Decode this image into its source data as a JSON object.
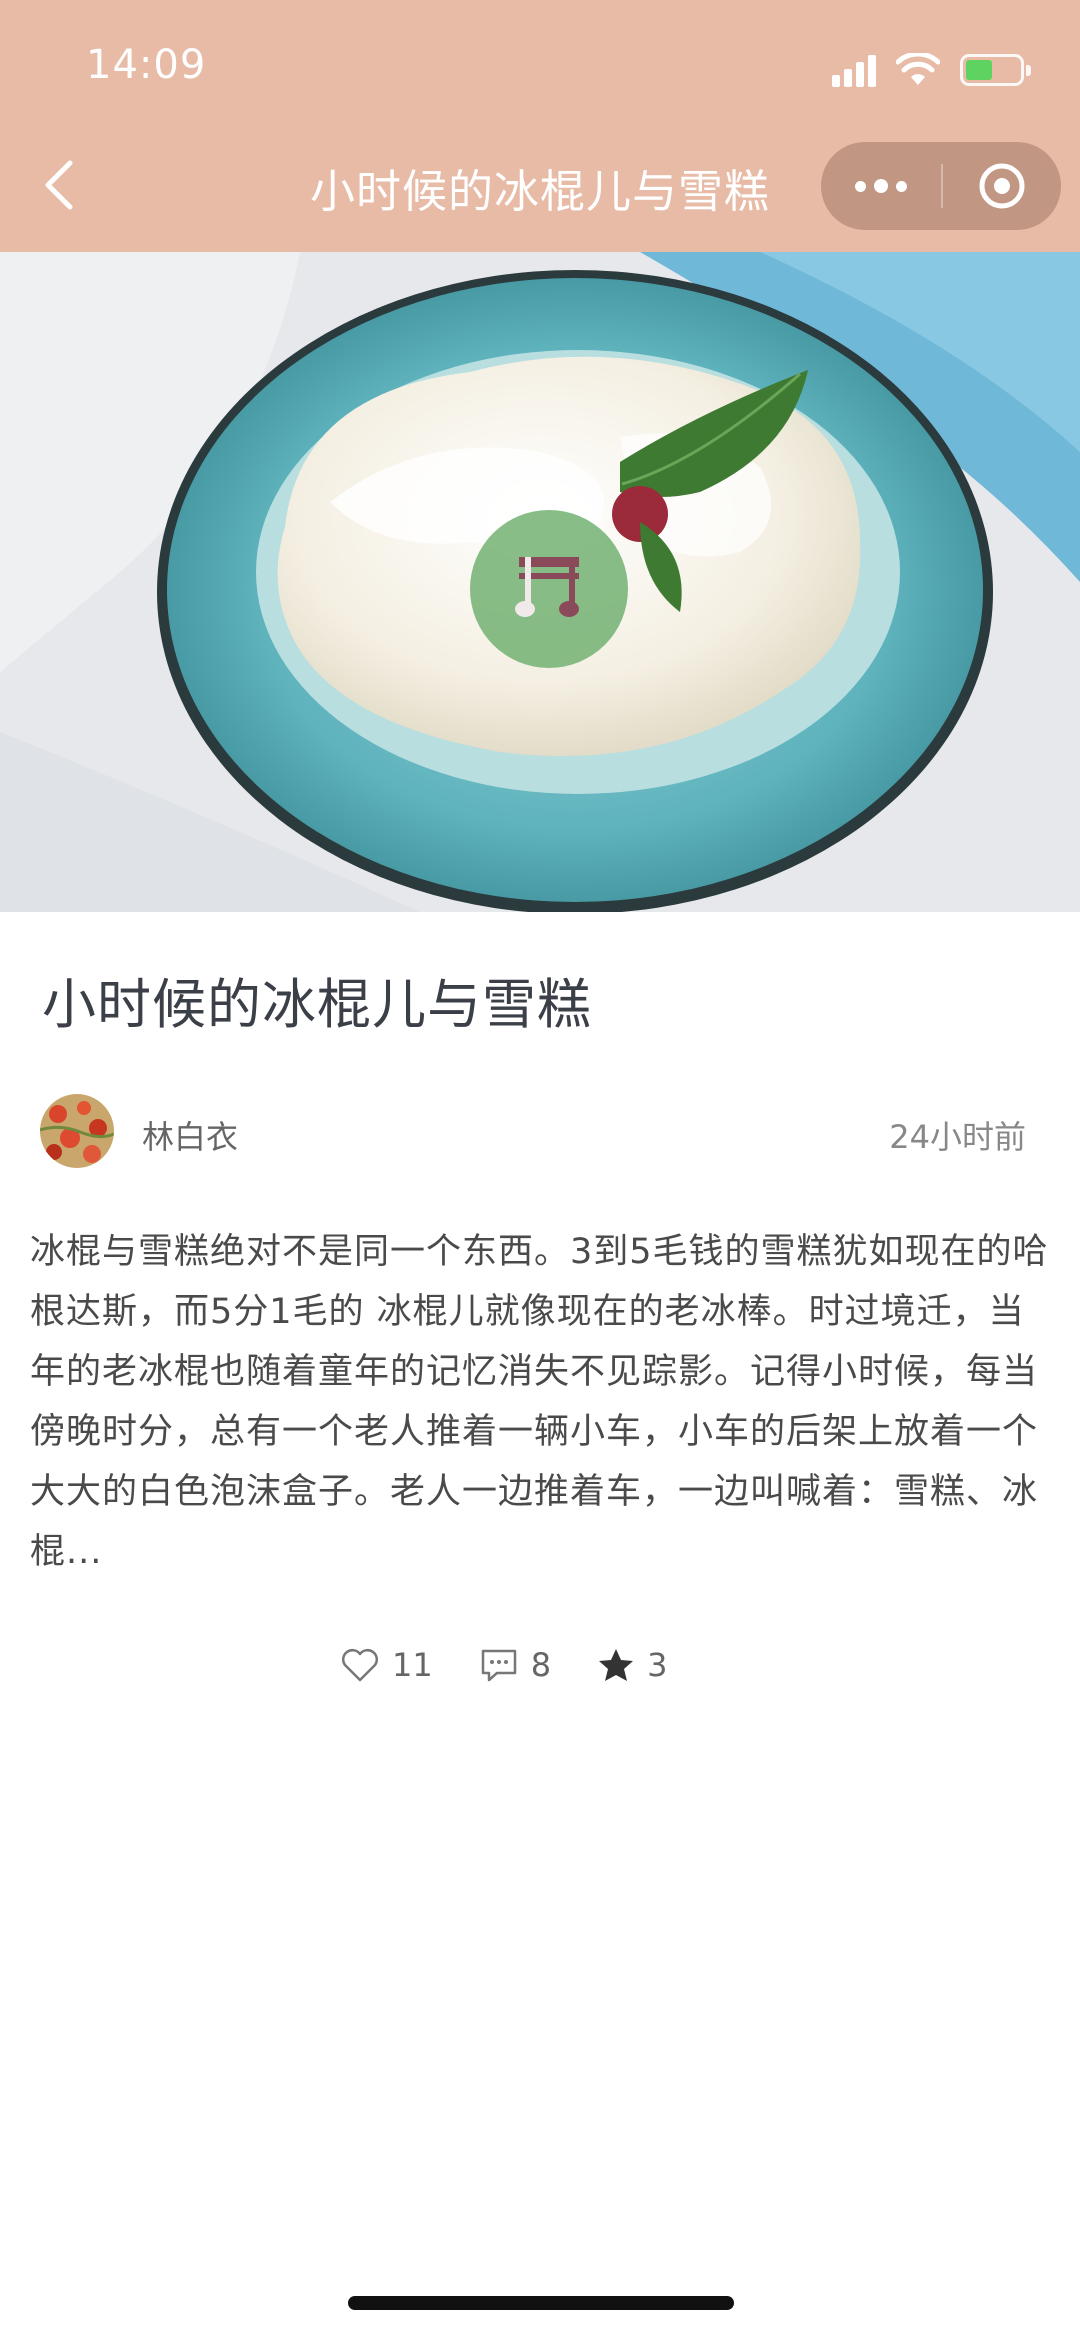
{
  "status_bar": {
    "time": "14:09",
    "icons": [
      "signal-icon",
      "wifi-icon",
      "battery-charging-icon"
    ]
  },
  "nav": {
    "title": "小时候的冰棍儿与雪糕",
    "back_icon": "chevron-left-icon",
    "more_icon": "more-dots-icon",
    "close_icon": "target-close-icon"
  },
  "hero": {
    "music_icon": "music-note-icon"
  },
  "article": {
    "title": "小时候的冰棍儿与雪糕",
    "author": "林白衣",
    "time": "24小时前",
    "excerpt": "冰棍与雪糕绝对不是同一个东西。3到5毛钱的雪糕犹如现在的哈根达斯，而5分1毛的 冰棍儿就像现在的老冰棒。时过境迁，当年的老冰棍也随着童年的记忆消失不见踪影。记得小时候，每当傍晚时分，总有一个老人推着一辆小车，小车的后架上放着一个大大的白色泡沫盒子。老人一边推着车，一边叫喊着：雪糕、冰棍..."
  },
  "actions": {
    "likes": "11",
    "comments": "8",
    "stars": "3"
  },
  "colors": {
    "nav_bg": "#e8bba7",
    "music_button": "#6eaf6e",
    "bowl": "#5fb3bd"
  }
}
